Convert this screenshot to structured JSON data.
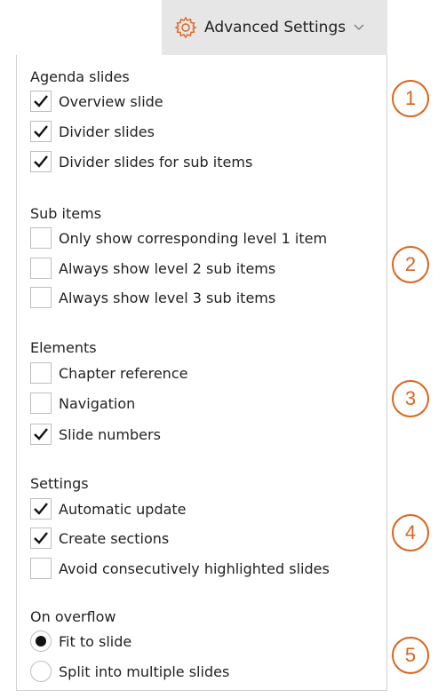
{
  "header": {
    "button_label": "Advanced Settings",
    "icons": [
      "gear-icon",
      "chevron-down-icon"
    ]
  },
  "colors": {
    "badge": "#d9651f",
    "header_bg": "#e6e6e6"
  },
  "sections": [
    {
      "title": "Agenda slides",
      "badge": "1",
      "items": [
        {
          "label": "Overview slide",
          "checked": true
        },
        {
          "label": "Divider slides",
          "checked": true
        },
        {
          "label": "Divider slides for sub items",
          "checked": true
        }
      ]
    },
    {
      "title": "Sub items",
      "badge": "2",
      "items": [
        {
          "label": "Only show corresponding level 1 item",
          "checked": false
        },
        {
          "label": "Always show level 2 sub items",
          "checked": false
        },
        {
          "label": "Always show level 3 sub items",
          "checked": false
        }
      ]
    },
    {
      "title": "Elements",
      "badge": "3",
      "items": [
        {
          "label": "Chapter reference",
          "checked": false
        },
        {
          "label": "Navigation",
          "checked": false
        },
        {
          "label": "Slide numbers",
          "checked": true
        }
      ]
    },
    {
      "title": "Settings",
      "badge": "4",
      "items": [
        {
          "label": "Automatic update",
          "checked": true
        },
        {
          "label": "Create sections",
          "checked": true
        },
        {
          "label": "Avoid consecutively highlighted slides",
          "checked": false
        }
      ]
    },
    {
      "title": "On overflow",
      "badge": "5",
      "type": "radio",
      "items": [
        {
          "label": "Fit to slide",
          "checked": true
        },
        {
          "label": "Split into multiple slides",
          "checked": false
        }
      ]
    }
  ]
}
